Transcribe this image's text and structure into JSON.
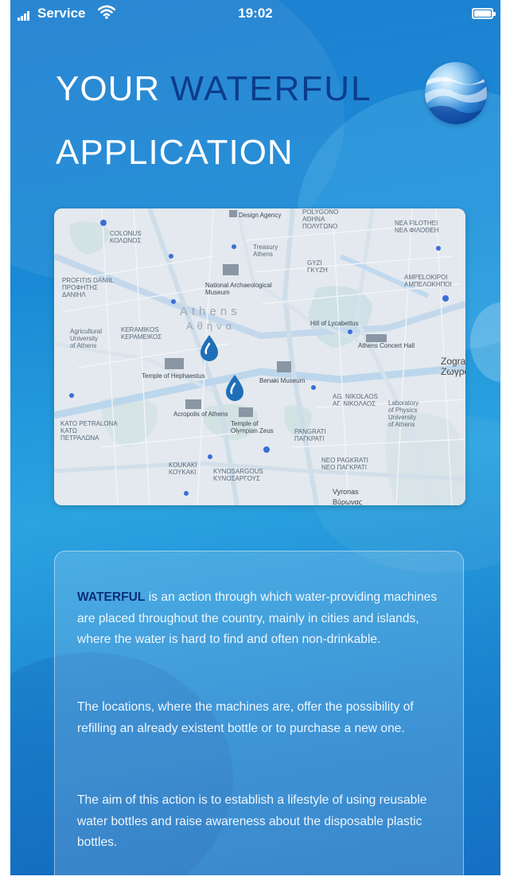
{
  "status_bar": {
    "carrier": "Service",
    "time": "19:02",
    "icons": [
      "signal-icon",
      "wifi-icon",
      "battery-icon"
    ]
  },
  "header": {
    "title_part1": "YOUR",
    "title_accent": "WATERFUL",
    "title_part2": "APPLICATION",
    "logo": "water-wave-logo"
  },
  "map": {
    "labels": {
      "colonus": "COLONUS\nΚΟΛΩΝΟΣ",
      "design_agency": "Design Agency",
      "polygono": "POLYGONO\nΑΘΗΝΑ\nΠΟΛΥΓΩΝΟ",
      "nea_filothei": "NEA FILOTHEI\nΝΕΑ ΦΙΛΟΘΕΗ",
      "treasury": "Treasury\nAthens",
      "gyzi": "GYZI\nΓΚΥΖΗ",
      "profitis": "PROFITIS DANIIL\nΠΡΟΦΗΤΗΣ\nΔΑΝΙΗΛ",
      "national_museum": "National Archaeological\nMuseum",
      "ampelokipoi": "AMPELOKIPOI\nΑΜΠΕΛΟΚΗΠΟΙ",
      "athens": "Athens",
      "athens_gr": "Αθήνα",
      "keramikos": "KERAMIKOS\nΚΕΡΑΜΕΙΚΟΣ",
      "agricultural": "Agricultural\nUniversity\nof Athens",
      "hill_of_lycabettus": "Hill of Lycabettus",
      "athens_concert_hall": "Athens Concert Hall",
      "zografou": "Zograf\nΖωγράφ",
      "temple_hephaestus": "Temple of Hephaestus",
      "benaki": "Benaki Museum",
      "kato_petralona": "KATO PETRALONA\nΚΑΤΩ\nΠΕΤΡΑΛΩΝΑ",
      "acropolis": "Acropolis of Athens",
      "olympian_zeus": "Temple of\nOlympian Zeus",
      "agios_nikolaos": "AG. NIKOLAOS\nΑΓ. ΝΙΚΟΛΑΟΣ",
      "pangrati": "PANGRATI\nΠΑΓΚΡΑΤΙ",
      "physics": "Laboratory\nof Physics\nUniversity\nof Athens",
      "koukaki": "KOUKAKI\nΚΟΥΚΑΚΙ",
      "kynosargous": "KYNOSARGOUS\nΚΥΝΟΣΑΡΓΟΥΣ",
      "nea_pagkrati": "NEO PAGKRATI\nΝΕΟ ΠΑΓΚΡΑΤΙ",
      "vyronas": "Vyronas\nΒύρωνας"
    },
    "markers": [
      "water-drop-marker",
      "water-drop-marker"
    ]
  },
  "info": {
    "brand": "WATERFUL",
    "p1_rest": " is an action through which water-providing machines are placed throughout the country, mainly in cities and islands, where the water is hard to find and often non-drinkable.",
    "p2": "The locations, where the machines are, offer the possibility of refilling an already existent bottle or to purchase a new one.",
    "p3": "The aim of this action is to establish a lifestyle of using reusable water bottles and raise awareness about the disposable plastic bottles."
  },
  "colors": {
    "background": "#1a8ad6",
    "accent": "#0d3c8c",
    "brand": "#0d2f7a",
    "text": "#eef6ff"
  }
}
